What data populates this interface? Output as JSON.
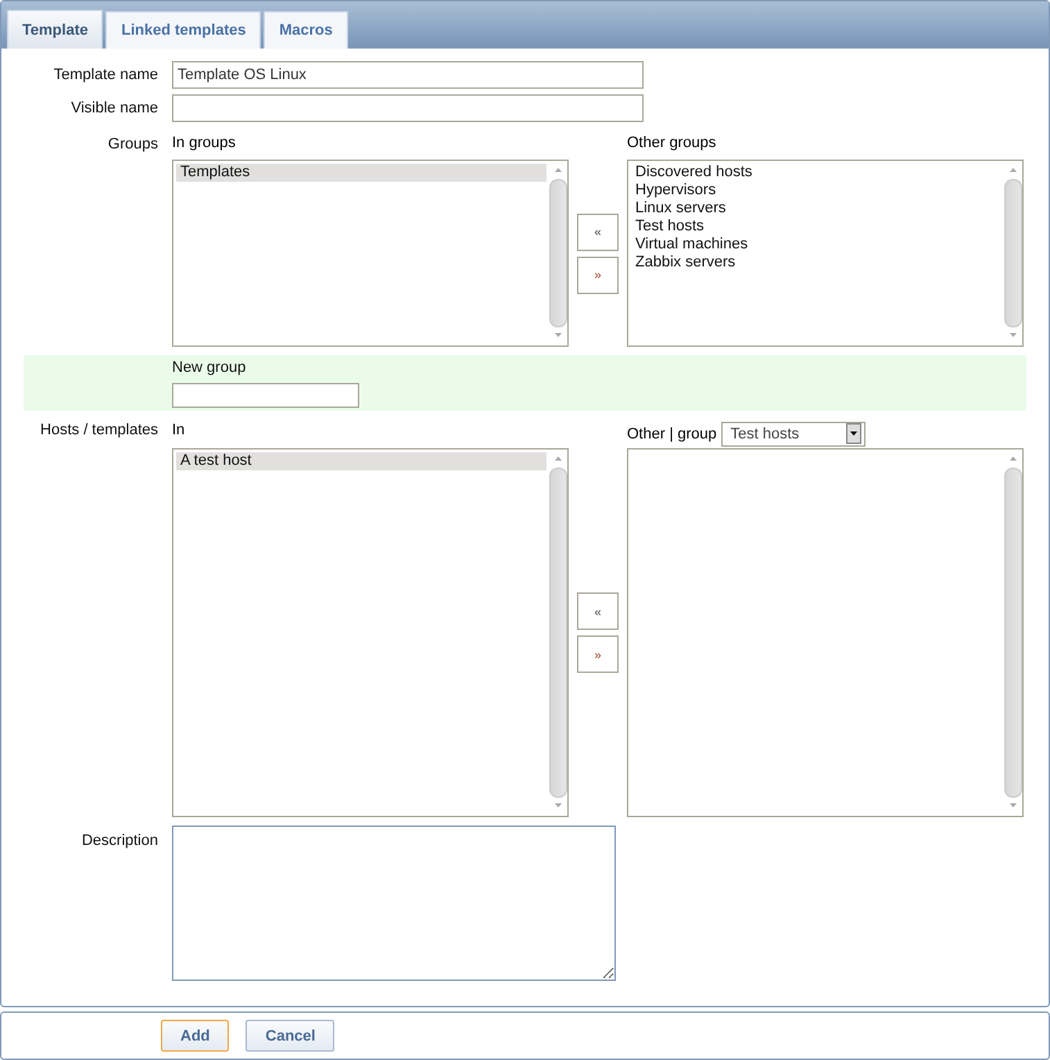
{
  "tabs": [
    {
      "label": "Template",
      "selected": true
    },
    {
      "label": "Linked templates",
      "selected": false
    },
    {
      "label": "Macros",
      "selected": false
    }
  ],
  "template_name": {
    "label": "Template name",
    "value": "Template OS Linux"
  },
  "visible_name": {
    "label": "Visible name"
  },
  "transfers": [
    {
      "label": "Groups",
      "in_title": "In groups",
      "in_items": [
        {
          "label": "Templates",
          "selected": true
        }
      ],
      "move_left": "«",
      "move_right": "»",
      "other_title": "Other groups",
      "other_items": [
        {
          "label": "Discovered hosts",
          "selected": false
        },
        {
          "label": "Hypervisors",
          "selected": false
        },
        {
          "label": "Linux servers",
          "selected": false
        },
        {
          "label": "Test hosts",
          "selected": false
        },
        {
          "label": "Virtual machines",
          "selected": false
        },
        {
          "label": "Zabbix servers",
          "selected": false
        }
      ]
    },
    {
      "label": "Hosts / templates",
      "in_title": "In",
      "in_items": [
        {
          "label": "A test host",
          "selected": true
        }
      ],
      "move_left": "«",
      "move_right": "»",
      "other_title": "Other | group",
      "group_select": "Test hosts"
    }
  ],
  "new_group": {
    "label": "New group"
  },
  "description": {
    "label": "Description"
  },
  "buttons": [
    {
      "label": "Add",
      "focused": true
    },
    {
      "label": "Cancel",
      "focused": false
    }
  ]
}
